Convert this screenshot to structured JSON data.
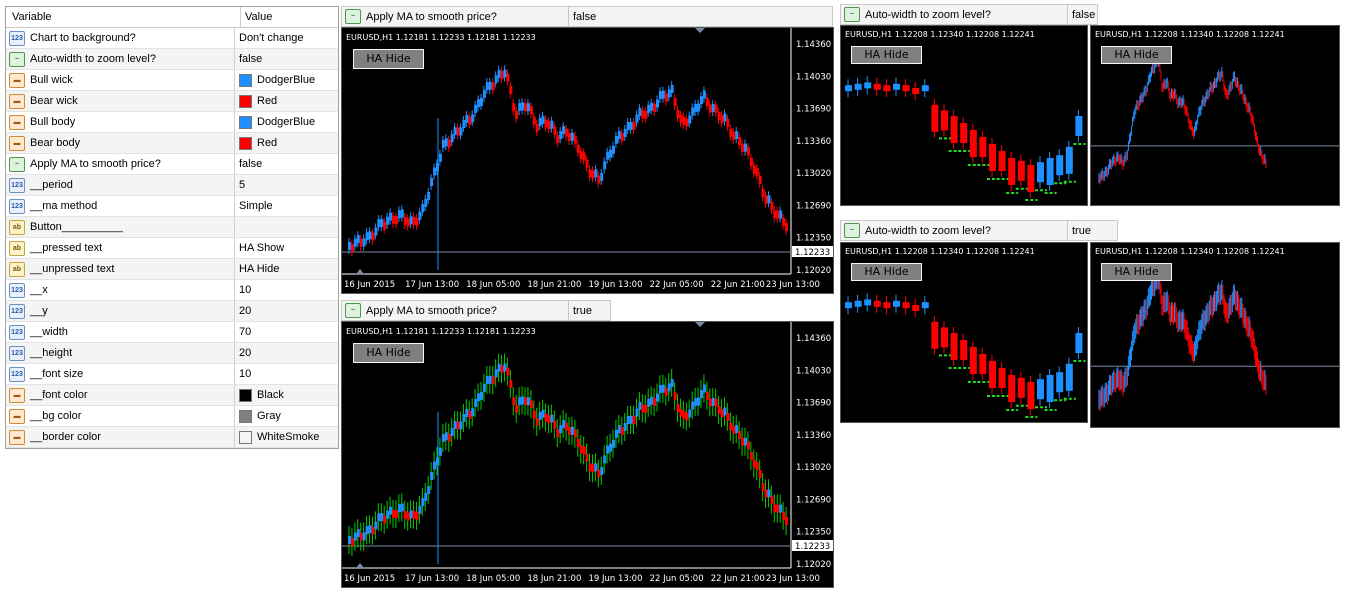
{
  "inputs": {
    "header": {
      "variable": "Variable",
      "value": "Value"
    },
    "rows": [
      {
        "icon": "num",
        "name": "Chart to background?",
        "value": "Don't change"
      },
      {
        "icon": "chart",
        "name": "Auto-width to zoom level?",
        "value": "false"
      },
      {
        "icon": "col",
        "name": "Bull wick",
        "value": "DodgerBlue",
        "color": "#1E90FF"
      },
      {
        "icon": "col",
        "name": "Bear wick",
        "value": "Red",
        "color": "#FF0000"
      },
      {
        "icon": "col",
        "name": "Bull body",
        "value": "DodgerBlue",
        "color": "#1E90FF"
      },
      {
        "icon": "col",
        "name": "Bear body",
        "value": "Red",
        "color": "#FF0000"
      },
      {
        "icon": "chart",
        "name": "Apply MA to smooth price?",
        "value": "false"
      },
      {
        "icon": "num",
        "name": "__period",
        "value": "5"
      },
      {
        "icon": "num",
        "name": "__ma method",
        "value": "Simple"
      },
      {
        "icon": "ab",
        "name": "Button__________",
        "value": ""
      },
      {
        "icon": "ab",
        "name": "__pressed text",
        "value": "HA Show"
      },
      {
        "icon": "ab",
        "name": "__unpressed text",
        "value": "HA Hide"
      },
      {
        "icon": "num",
        "name": "__x",
        "value": "10"
      },
      {
        "icon": "num",
        "name": "__y",
        "value": "20"
      },
      {
        "icon": "num",
        "name": "__width",
        "value": "70"
      },
      {
        "icon": "num",
        "name": "__height",
        "value": "20"
      },
      {
        "icon": "num",
        "name": "__font size",
        "value": "10"
      },
      {
        "icon": "col",
        "name": "__font color",
        "value": "Black",
        "color": "#000000"
      },
      {
        "icon": "col",
        "name": "__bg color",
        "value": "Gray",
        "color": "#808080"
      },
      {
        "icon": "col",
        "name": "__border color",
        "value": "WhiteSmoke",
        "color": "#F5F5F5"
      }
    ]
  },
  "bars": {
    "ma_false": {
      "label": "Apply MA to smooth price?",
      "value": "false"
    },
    "ma_true": {
      "label": "Apply MA to smooth price?",
      "value": "true"
    },
    "auto_false": {
      "label": "Auto-width to zoom level?",
      "value": "false"
    },
    "auto_true": {
      "label": "Auto-width to zoom level?",
      "value": "true"
    }
  },
  "charts": {
    "large_header": "EURUSD,H1  1.12181 1.12233 1.12181 1.12233",
    "small_header": "EURUSD,H1  1.12208 1.12340 1.12208 1.12241",
    "button_label": "HA Hide",
    "price_labels": [
      "1.14360",
      "1.14030",
      "1.13690",
      "1.13360",
      "1.13020",
      "1.12690",
      "1.12350",
      "1.12020"
    ],
    "current_price": "1.12233",
    "time_labels": [
      "16 Jun 2015",
      "17 Jun 13:00",
      "18 Jun 05:00",
      "18 Jun 21:00",
      "19 Jun 13:00",
      "22 Jun 05:00",
      "22 Jun 21:00",
      "23 Jun 13:00"
    ]
  },
  "colors": {
    "bull": "#1E90FF",
    "bear": "#FF0000",
    "wick_green": "#00CC00",
    "grid": "#7a8ba0"
  }
}
